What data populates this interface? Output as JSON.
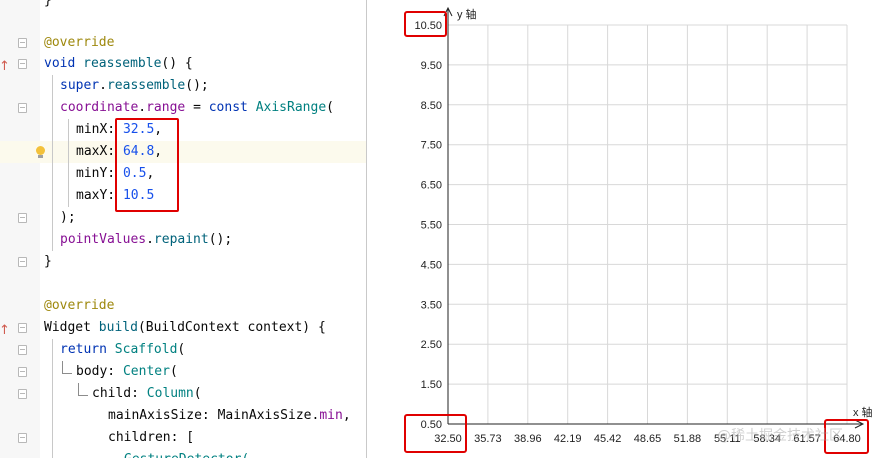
{
  "editor": {
    "lines": [
      {
        "tokens": [
          {
            "t": "}",
            "c": ""
          }
        ]
      },
      {
        "tokens": []
      },
      {
        "tokens": [
          {
            "t": "@override",
            "c": "t-ann"
          }
        ]
      },
      {
        "tokens": [
          {
            "t": "void ",
            "c": "t-kw"
          },
          {
            "t": "reassemble",
            "c": "t-fn"
          },
          {
            "t": "() {",
            "c": ""
          }
        ]
      },
      {
        "tokens": [
          {
            "t": "super",
            "c": "t-kw"
          },
          {
            "t": ".",
            "c": ""
          },
          {
            "t": "reassemble",
            "c": "t-fn"
          },
          {
            "t": "();",
            "c": ""
          }
        ]
      },
      {
        "tokens": [
          {
            "t": "coordinate",
            "c": "t-fld"
          },
          {
            "t": ".",
            "c": ""
          },
          {
            "t": "range",
            "c": "t-fld"
          },
          {
            "t": " = ",
            "c": ""
          },
          {
            "t": "const ",
            "c": "t-kw"
          },
          {
            "t": "AxisRange",
            "c": "t-cls"
          },
          {
            "t": "(",
            "c": ""
          }
        ]
      },
      {
        "tokens": [
          {
            "t": "minX: ",
            "c": ""
          },
          {
            "t": "32.5",
            "c": "t-num"
          },
          {
            "t": ",",
            "c": ""
          }
        ]
      },
      {
        "tokens": [
          {
            "t": "maxX: ",
            "c": ""
          },
          {
            "t": "64.8",
            "c": "t-num"
          },
          {
            "t": ",",
            "c": ""
          }
        ]
      },
      {
        "tokens": [
          {
            "t": "minY: ",
            "c": ""
          },
          {
            "t": "0.5",
            "c": "t-num"
          },
          {
            "t": ",",
            "c": ""
          }
        ]
      },
      {
        "tokens": [
          {
            "t": "maxY: ",
            "c": ""
          },
          {
            "t": "10.5",
            "c": "t-num"
          }
        ]
      },
      {
        "tokens": [
          {
            "t": ");",
            "c": ""
          }
        ]
      },
      {
        "tokens": [
          {
            "t": "pointValues",
            "c": "t-fld"
          },
          {
            "t": ".",
            "c": ""
          },
          {
            "t": "repaint",
            "c": "t-fn"
          },
          {
            "t": "();",
            "c": ""
          }
        ]
      },
      {
        "tokens": [
          {
            "t": "}",
            "c": ""
          }
        ]
      },
      {
        "tokens": []
      },
      {
        "tokens": [
          {
            "t": "@override",
            "c": "t-ann"
          }
        ]
      },
      {
        "tokens": [
          {
            "t": "Widget ",
            "c": ""
          },
          {
            "t": "build",
            "c": "t-fn"
          },
          {
            "t": "(BuildContext context) {",
            "c": ""
          }
        ]
      },
      {
        "tokens": [
          {
            "t": "return ",
            "c": "t-kw"
          },
          {
            "t": "Scaffold",
            "c": "t-cls"
          },
          {
            "t": "(",
            "c": ""
          }
        ]
      },
      {
        "tokens": [
          {
            "t": "body: ",
            "c": ""
          },
          {
            "t": "Center",
            "c": "t-cls"
          },
          {
            "t": "(",
            "c": ""
          }
        ]
      },
      {
        "tokens": [
          {
            "t": "child: ",
            "c": ""
          },
          {
            "t": "Column",
            "c": "t-cls"
          },
          {
            "t": "(",
            "c": ""
          }
        ]
      },
      {
        "tokens": [
          {
            "t": "mainAxisSize: MainAxisSize.",
            "c": ""
          },
          {
            "t": "min",
            "c": "t-fld"
          },
          {
            "t": ",",
            "c": ""
          }
        ]
      },
      {
        "tokens": [
          {
            "t": "children: [",
            "c": ""
          }
        ]
      },
      {
        "tokens": [
          {
            "t": "GestureDetector(",
            "c": "t-cls"
          }
        ]
      }
    ]
  },
  "chart_data": {
    "type": "scatter",
    "x_axis_label": "x 轴",
    "y_axis_label": "y 轴",
    "xlim": [
      32.5,
      64.8
    ],
    "ylim": [
      0.5,
      10.5
    ],
    "x_tick_labels": [
      "32.50",
      "35.73",
      "38.96",
      "42.19",
      "45.42",
      "48.65",
      "51.88",
      "55.11",
      "58.34",
      "61.57",
      "64.80"
    ],
    "y_tick_labels": [
      "0.50",
      "1.50",
      "2.50",
      "3.50",
      "4.50",
      "5.50",
      "6.50",
      "7.50",
      "8.50",
      "9.50",
      "10.50"
    ],
    "grid": true,
    "points": []
  },
  "colors": {
    "highlight_box": "#e00000",
    "grid": "#d8d8d8",
    "axis": "#222222"
  },
  "watermark": "@稀土掘金技术社区"
}
